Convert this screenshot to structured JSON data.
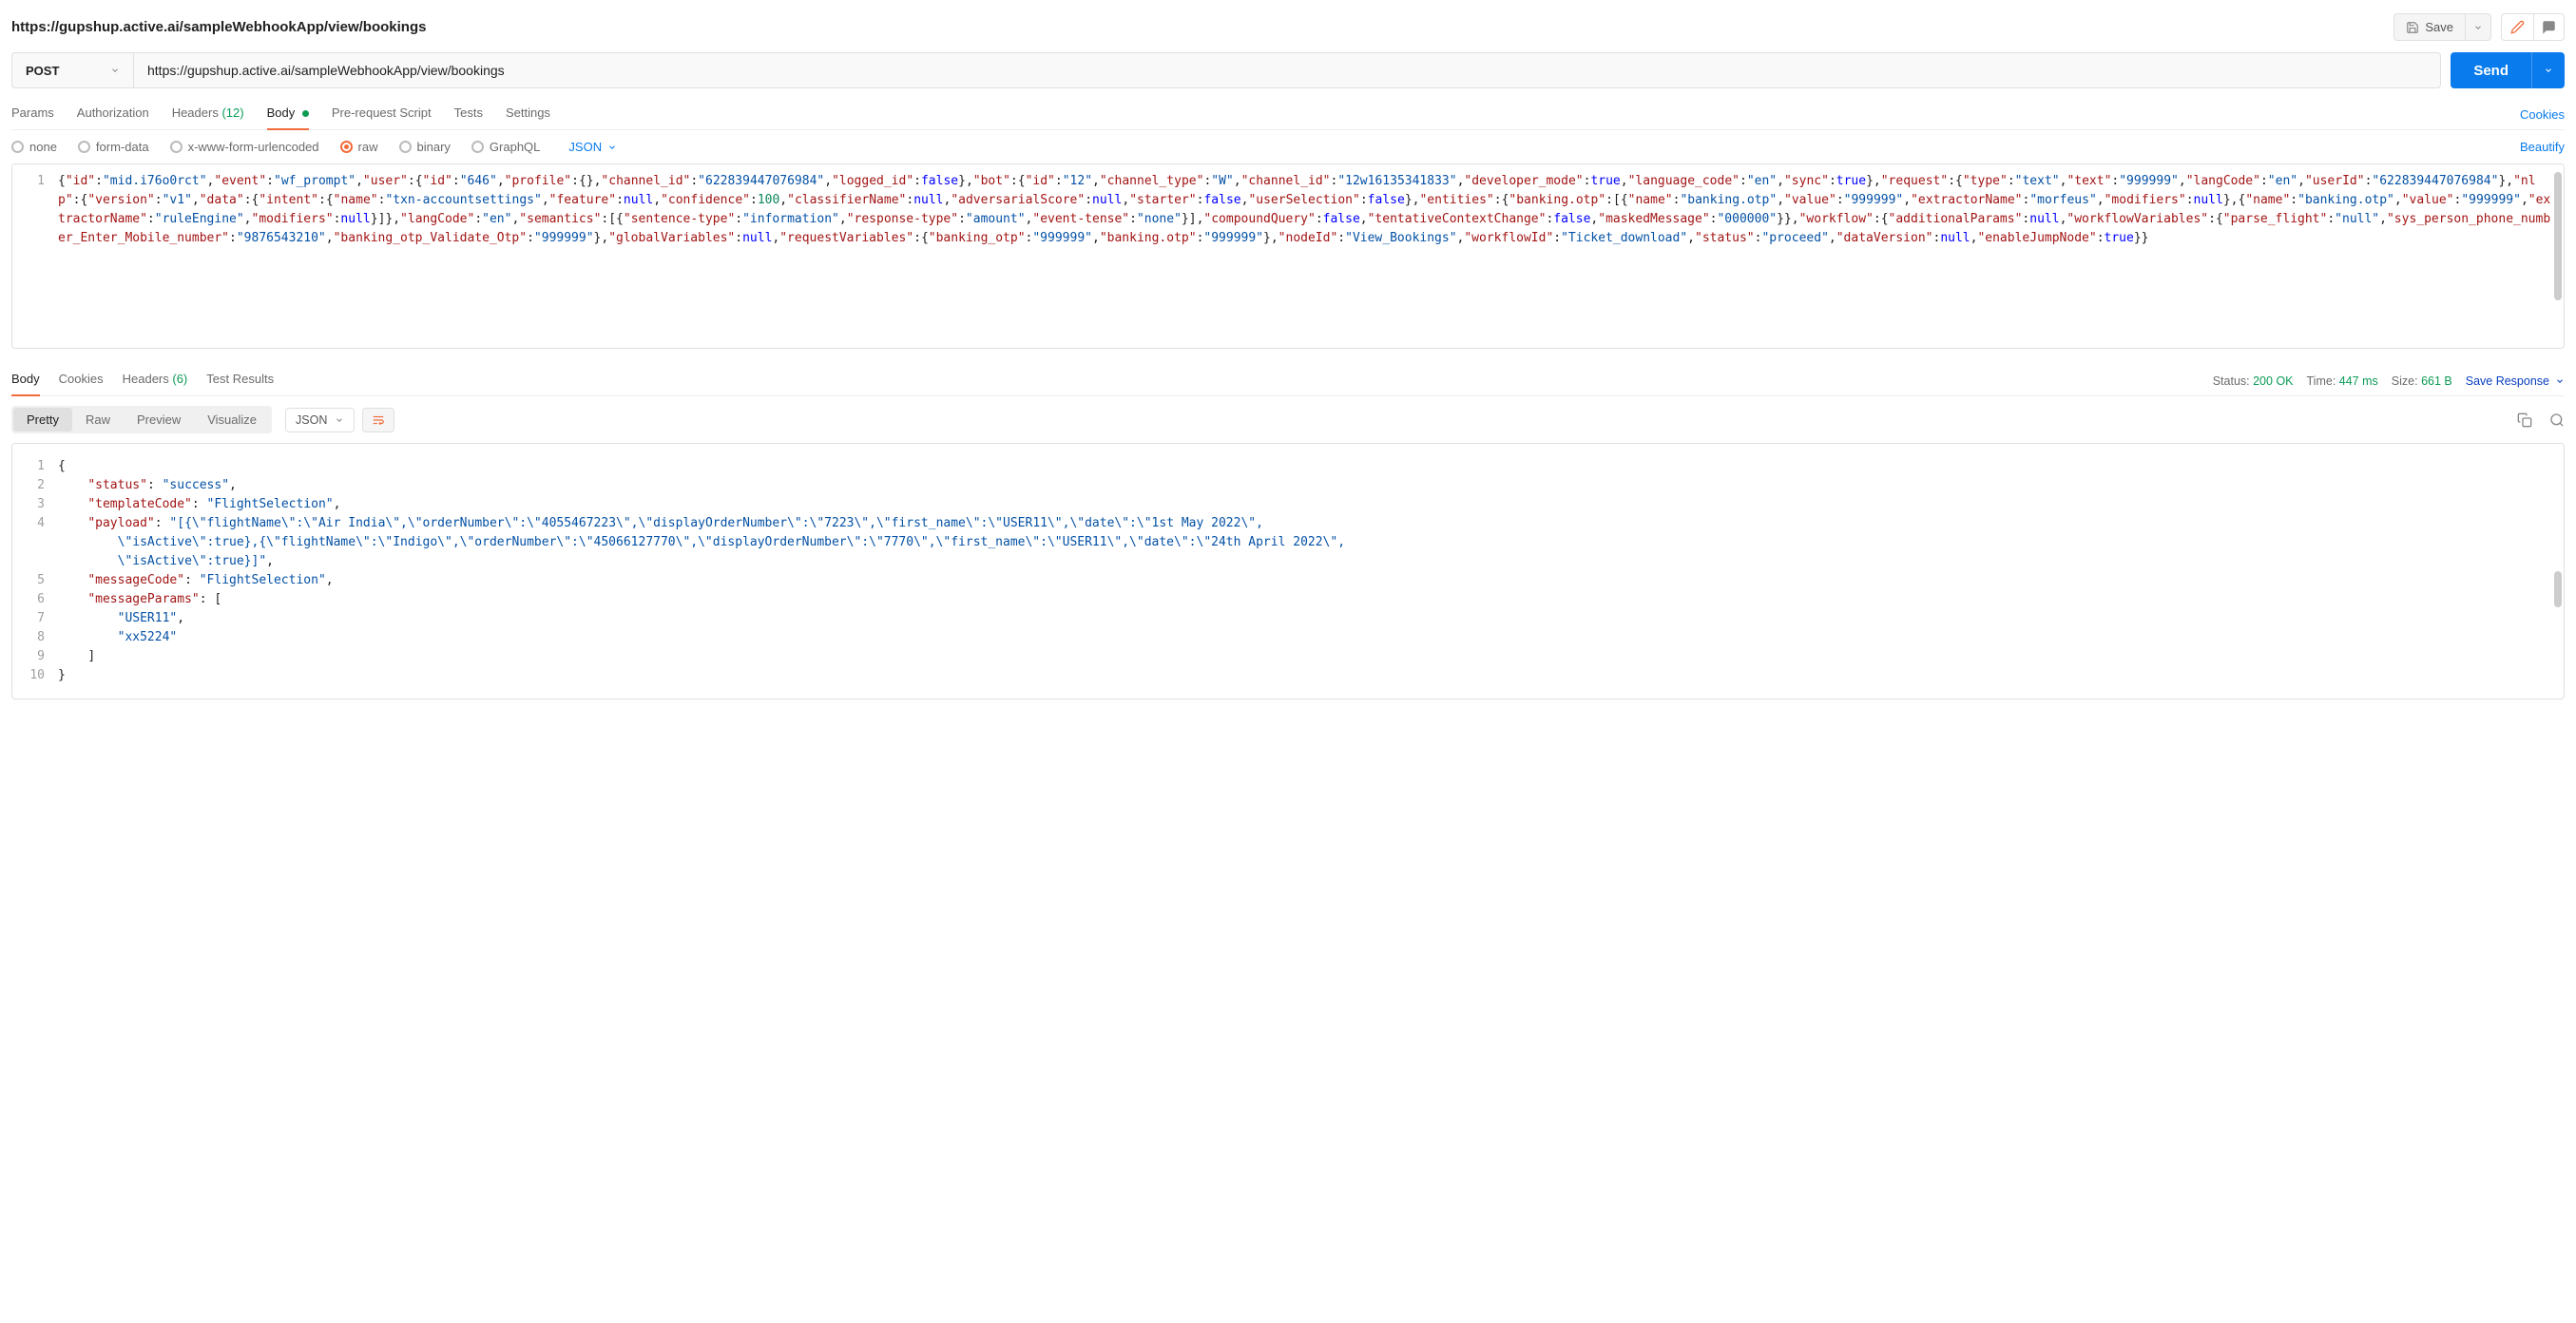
{
  "header": {
    "title": "https://gupshup.active.ai/sampleWebhookApp/view/bookings",
    "save_label": "Save"
  },
  "urlbar": {
    "method": "POST",
    "url": "https://gupshup.active.ai/sampleWebhookApp/view/bookings",
    "send_label": "Send"
  },
  "tabs": {
    "params": "Params",
    "authorization": "Authorization",
    "headers": "Headers",
    "headers_count": "(12)",
    "body": "Body",
    "prerequest": "Pre-request Script",
    "tests": "Tests",
    "settings": "Settings",
    "cookies": "Cookies"
  },
  "bodytypes": {
    "none": "none",
    "formdata": "form-data",
    "xwww": "x-www-form-urlencoded",
    "raw": "raw",
    "binary": "binary",
    "graphql": "GraphQL",
    "lang": "JSON",
    "beautify": "Beautify"
  },
  "request_editor": {
    "line_number": "1"
  },
  "request_body": {
    "id": "mid.i76o0rct",
    "event": "wf_prompt",
    "user": {
      "id": "646",
      "profile": {},
      "channel_id": "622839447076984",
      "logged_id": false
    },
    "bot": {
      "id": "12",
      "channel_type": "W",
      "channel_id": "12w16135341833",
      "developer_mode": true,
      "language_code": "en",
      "sync": true
    },
    "request": {
      "type": "text",
      "text": "999999",
      "langCode": "en",
      "userId": "622839447076984"
    },
    "nlp": {
      "version": "v1",
      "data": {
        "intent": {
          "name": "txn-accountsettings",
          "feature": null,
          "confidence": 100.0,
          "classifierName": null,
          "adversarialScore": null,
          "starter": false,
          "userSelection": false
        },
        "entities": {
          "banking.otp": [
            {
              "name": "banking.otp",
              "value": "999999",
              "extractorName": "morfeus",
              "modifiers": null
            },
            {
              "name": "banking.otp",
              "value": "999999",
              "extractorName": "ruleEngine",
              "modifiers": null
            }
          ]
        },
        "langCode": "en",
        "semantics": [
          {
            "sentence-type": "information",
            "response-type": "amount",
            "event-tense": "none"
          }
        ],
        "compoundQuery": false,
        "tentativeContextChange": false,
        "maskedMessage": "000000"
      }
    },
    "workflow": {
      "additionalParams": null,
      "workflowVariables": {
        "parse_flight": "null",
        "sys_person_phone_number_Enter_Mobile_number": "9876543210",
        "banking_otp_Validate_Otp": "999999"
      },
      "globalVariables": null,
      "requestVariables": {
        "banking_otp": "999999",
        "banking.otp": "999999"
      },
      "nodeId": "View_Bookings",
      "workflowId": "Ticket_download",
      "status": "proceed",
      "dataVersion": null,
      "enableJumpNode": true
    }
  },
  "response_tabs": {
    "body": "Body",
    "cookies": "Cookies",
    "headers": "Headers",
    "headers_count": "(6)",
    "test_results": "Test Results"
  },
  "response_status": {
    "status_label": "Status:",
    "status_value": "200 OK",
    "time_label": "Time:",
    "time_value": "447 ms",
    "size_label": "Size:",
    "size_value": "661 B",
    "save_response": "Save Response"
  },
  "response_views": {
    "pretty": "Pretty",
    "raw": "Raw",
    "preview": "Preview",
    "visualize": "Visualize",
    "lang": "JSON"
  },
  "response_body": {
    "status": "success",
    "templateCode": "FlightSelection",
    "payload": "[{\"flightName\":\"Air India\",\"orderNumber\":\"4055467223\",\"displayOrderNumber\":\"7223\",\"first_name\":\"USER11\",\"date\":\"1st May 2022\",\"isActive\":true},{\"flightName\":\"Indigo\",\"orderNumber\":\"45066127770\",\"displayOrderNumber\":\"7770\",\"first_name\":\"USER11\",\"date\":\"24th April 2022\",\"isActive\":true}]",
    "messageCode": "FlightSelection",
    "messageParams": [
      "USER11",
      "xx5224"
    ]
  },
  "response_lines": [
    "1",
    "2",
    "3",
    "4",
    "5",
    "6",
    "7",
    "8",
    "9",
    "10"
  ]
}
